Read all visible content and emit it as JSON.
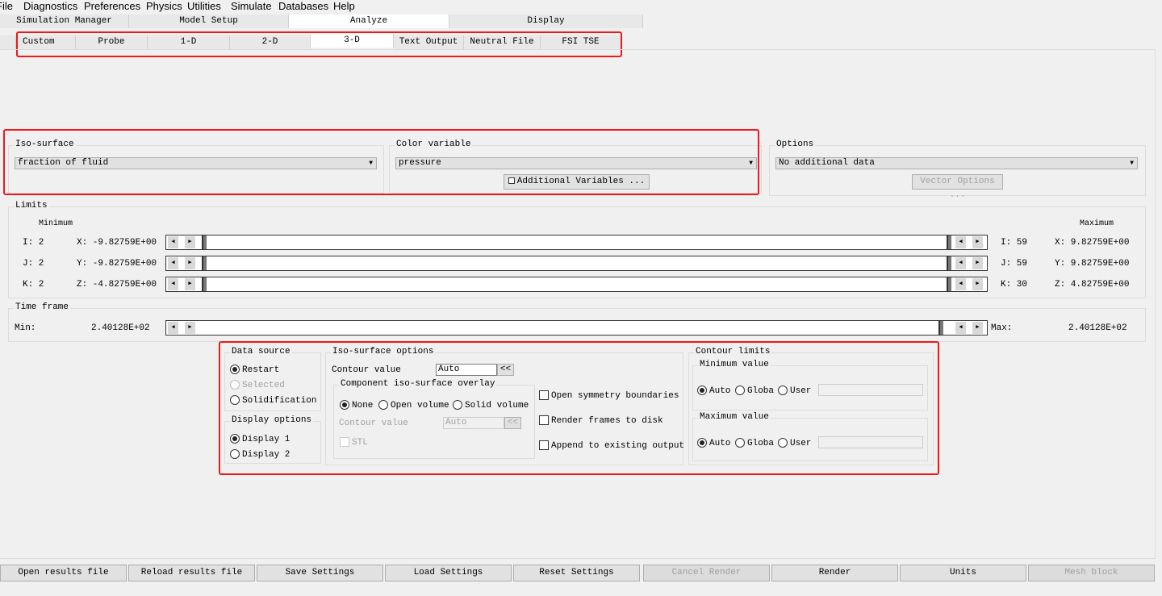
{
  "menu": [
    "File",
    "Diagnostics",
    "Preferences",
    "Physics",
    "Utilities",
    "Simulate",
    "Databases",
    "Help"
  ],
  "main_tabs": [
    "Simulation Manager",
    "Model Setup",
    "Analyze",
    "Display"
  ],
  "sub_tabs": [
    "Custom",
    "Probe",
    "1-D",
    "2-D",
    "3-D",
    "Text Output",
    "Neutral File",
    "FSI TSE"
  ],
  "iso_surface": {
    "label": "Iso-surface",
    "value": "fraction of fluid"
  },
  "color_variable": {
    "label": "Color variable",
    "value": "pressure",
    "additional": "Additional Variables ..."
  },
  "options": {
    "label": "Options",
    "value": "No additional data",
    "vector": "Vector Options ..."
  },
  "limits": {
    "label": "Limits",
    "minimum": "Minimum",
    "maximum": "Maximum",
    "rows": [
      {
        "imin": "I: 2",
        "cmin": "X: -9.82759E+00",
        "imax": "I: 59",
        "cmax": "X: 9.82759E+00"
      },
      {
        "imin": "J: 2",
        "cmin": "Y: -9.82759E+00",
        "imax": "J: 59",
        "cmax": "Y: 9.82759E+00"
      },
      {
        "imin": "K: 2",
        "cmin": "Z: -4.82759E+00",
        "imax": "K: 30",
        "cmax": "Z: 4.82759E+00"
      }
    ]
  },
  "time_frame": {
    "label": "Time frame",
    "min_label": "Min:",
    "min": "2.40128E+02",
    "max_label": "Max:",
    "max": "2.40128E+02"
  },
  "data_source": {
    "label": "Data source",
    "items": [
      "Restart",
      "Selected",
      "Solidification"
    ]
  },
  "display_options": {
    "label": "Display options",
    "items": [
      "Display 1",
      "Display 2"
    ]
  },
  "iso_options": {
    "label": "Iso-surface options",
    "contour_label": "Contour value",
    "contour": "Auto",
    "arrow": "<<",
    "overlay": {
      "label": "Component iso-surface overlay",
      "items": [
        "None",
        "Open volume",
        "Solid volume"
      ],
      "contour_label": "Contour value",
      "contour": "Auto",
      "stl": "STL"
    },
    "checks": [
      "Open symmetry boundaries",
      "Render frames to disk",
      "Append to existing output"
    ]
  },
  "contour_limits": {
    "label": "Contour limits",
    "min_label": "Minimum value",
    "max_label": "Maximum value",
    "items": [
      "Auto",
      "Globa",
      "User"
    ]
  },
  "bottom": [
    "Open results file",
    "Reload results file",
    "Save Settings",
    "Load Settings",
    "Reset Settings",
    "Cancel Render",
    "Render",
    "Units",
    "Mesh block"
  ]
}
